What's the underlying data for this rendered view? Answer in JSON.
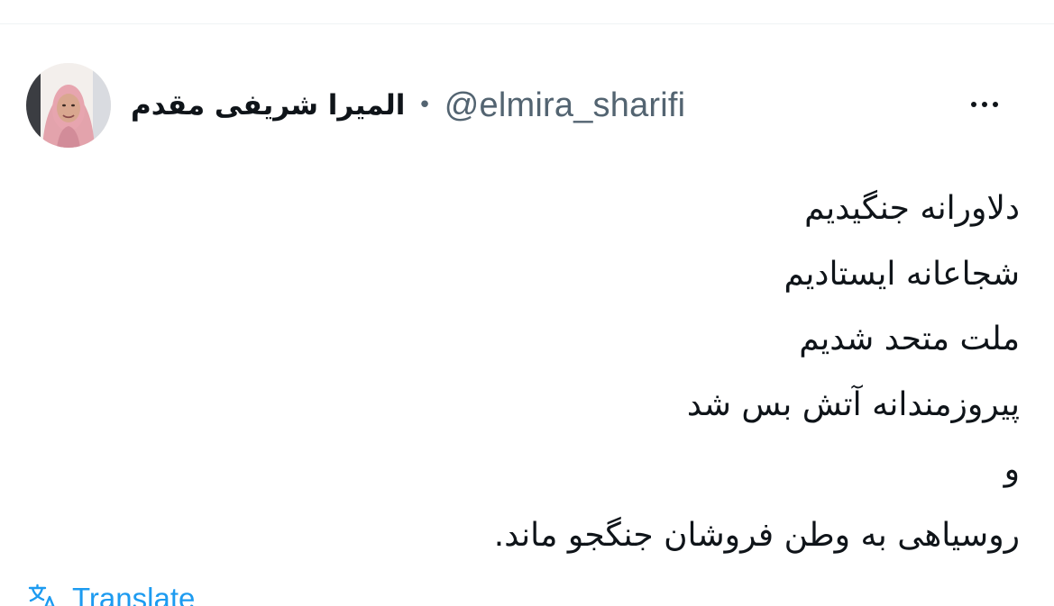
{
  "header": {
    "display_name": "المیرا شریفی مقدم",
    "separator": "•",
    "handle": "@elmira_sharifi"
  },
  "tweet": {
    "lines": [
      "دلاورانه جنگیدیم",
      "شجاعانه ایستادیم",
      "ملت متحد شدیم",
      "پیروزمندانه آتش بس شد",
      "و",
      "روسیاهی به وطن فروشان جنگجو ماند."
    ]
  },
  "actions": {
    "more_icon": "more-horizontal-icon",
    "translate_icon": "translate-icon",
    "translate_label": "Translate"
  },
  "colors": {
    "text": "#0f1419",
    "secondary": "#536471",
    "link": "#1d9bf0",
    "hijab": "#e3a3ac"
  }
}
